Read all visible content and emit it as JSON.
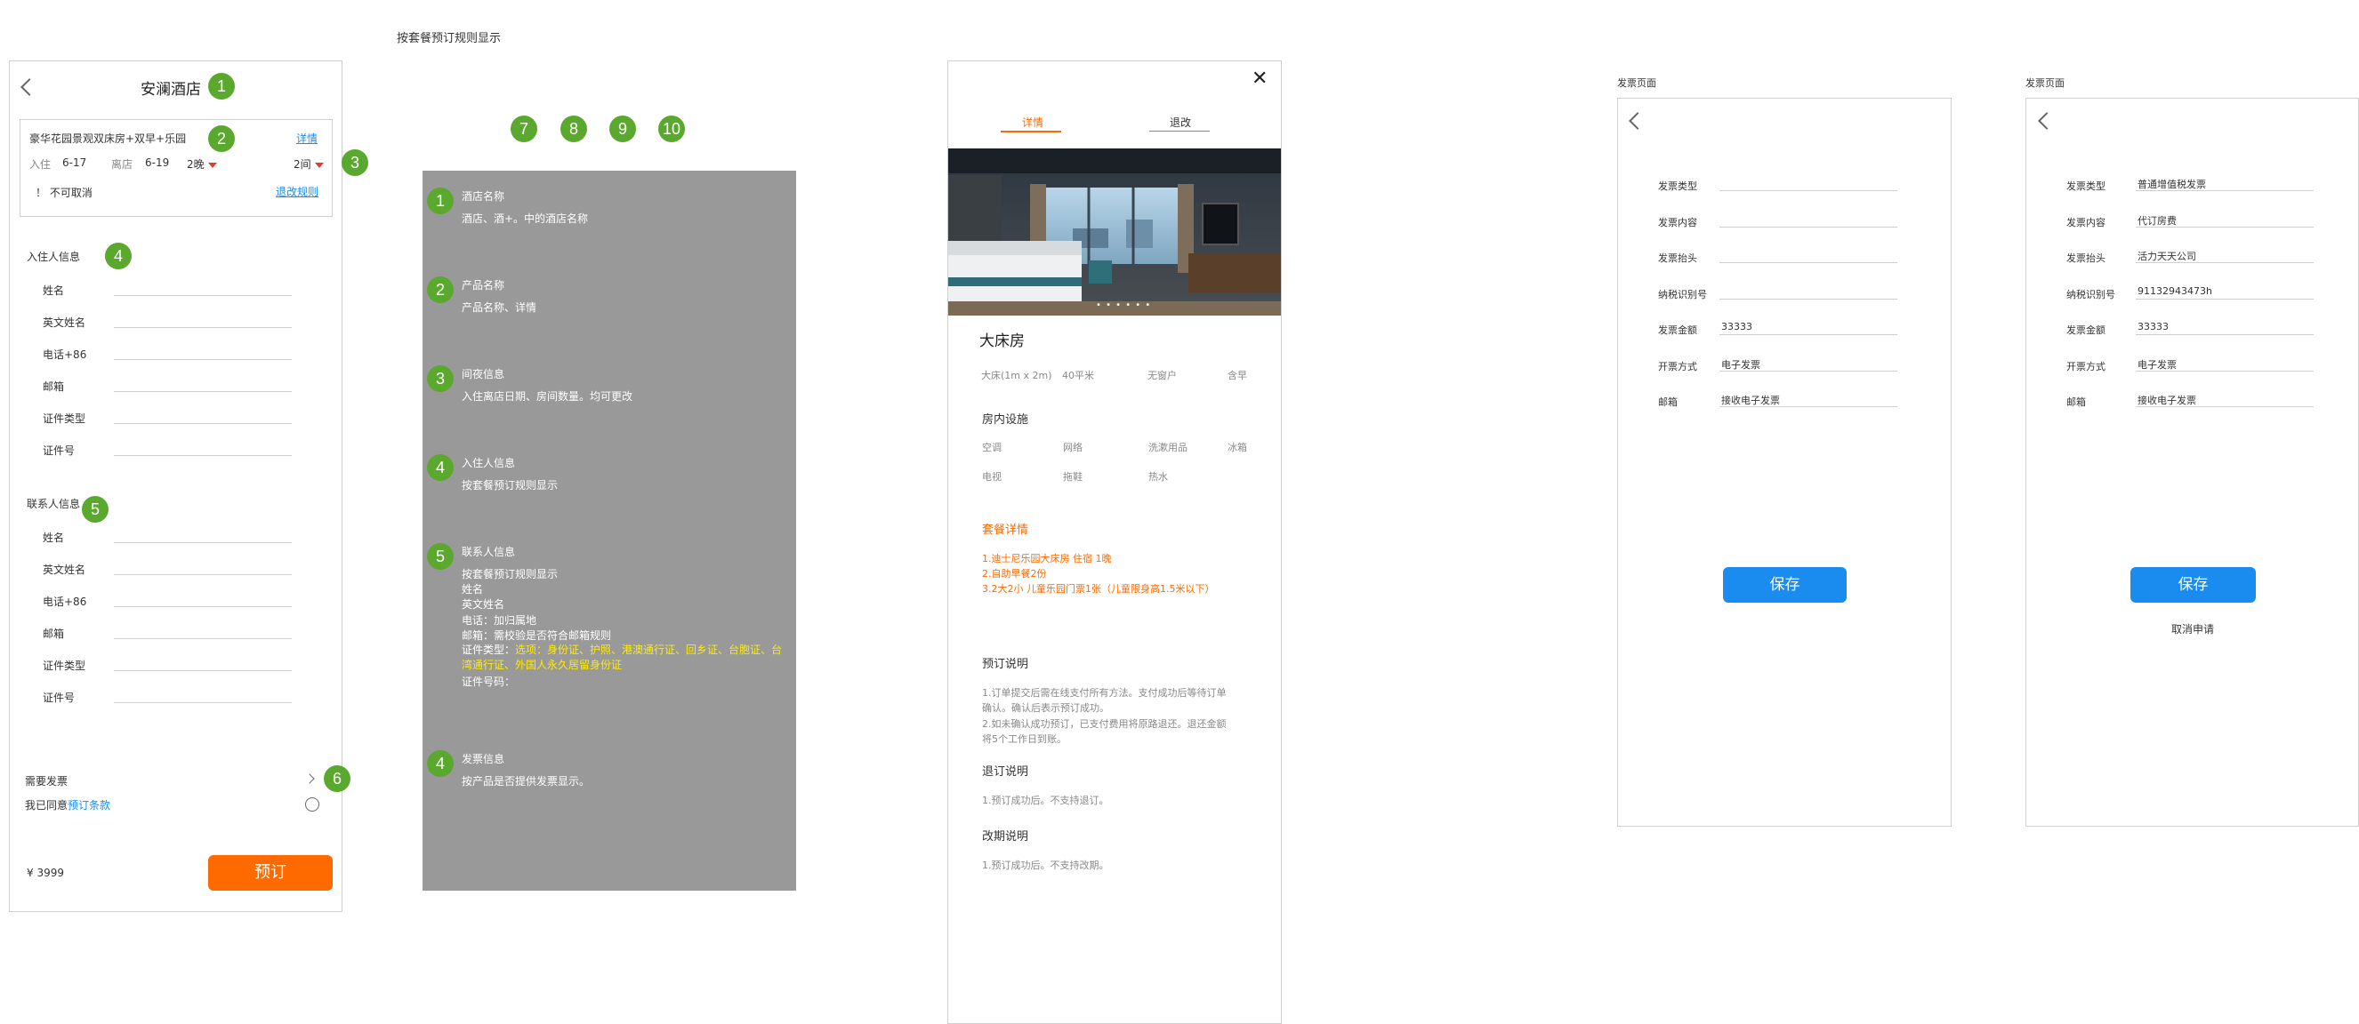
{
  "top_note": "按套餐预订规则显示",
  "booking": {
    "title": "安澜酒店",
    "product": "豪华花园景观双床房+双早+乐园",
    "detail_link": "详情",
    "checkin_label": "入住",
    "checkin_date": "6-17",
    "checkout_label": "离店",
    "checkout_date": "6-19",
    "nights": "2晚",
    "rooms": "2间",
    "cancel_note": "！ 不可取消",
    "change_rule": "退改规则",
    "guest_section": "入住人信息",
    "guest_fields": [
      "姓名",
      "英文姓名",
      "电话+86",
      "邮箱",
      "证件类型",
      "证件号"
    ],
    "contact_section": "联系人信息",
    "contact_fields": [
      "姓名",
      "英文姓名",
      "电话+86",
      "邮箱",
      "证件类型",
      "证件号"
    ],
    "invoice_label": "需要发票",
    "agree_prefix": "我已同意",
    "agree_link": "预订条款",
    "price": "¥ 3999",
    "book_button": "预订"
  },
  "badges": [
    "1",
    "2",
    "3",
    "4",
    "5",
    "6",
    "7",
    "8",
    "9",
    "10"
  ],
  "notes": [
    {
      "num": "1",
      "title": "酒店名称",
      "body": "酒店、酒+。中的酒店名称"
    },
    {
      "num": "2",
      "title": "产品名称",
      "body": "产品名称、详情"
    },
    {
      "num": "3",
      "title": "间夜信息",
      "body": "入住离店日期、房间数量。均可更改"
    },
    {
      "num": "4",
      "title": "入住人信息",
      "body": "按套餐预订规则显示"
    },
    {
      "num": "5",
      "title": "联系人信息",
      "body_lines": [
        "按套餐预订规则显示",
        "姓名",
        "英文姓名",
        "电话：加归属地",
        "邮箱：需校验是否符合邮箱规则"
      ],
      "id_prefix": "证件类型：",
      "id_options": "选项：身份证、护照、港澳通行证、回乡证、台胞证、台湾通行证、外国人永久居留身份证",
      "id_number": "证件号码："
    },
    {
      "num": "4",
      "title": "发票信息",
      "body": "按产品是否提供发票显示。"
    }
  ],
  "detail": {
    "close": "✕",
    "tab_active": "详情",
    "tab_other": "退改",
    "room_name": "大床房",
    "room_specs": [
      "大床(1m x 2m)",
      "40平米",
      "无窗户",
      "含早"
    ],
    "facilities_title": "房内设施",
    "facilities": [
      "空调",
      "网络",
      "洗漱用品",
      "冰箱",
      "电视",
      "拖鞋",
      "热水"
    ],
    "package_title": "套餐详情",
    "package_items": [
      "1.迪士尼乐园大床房 住宿 1晚",
      "2.自助早餐2份",
      "3.2大2小 儿童乐园门票1张（儿童限身高1.5米以下）"
    ],
    "booking_title": "预订说明",
    "booking_lines": [
      "1.订单提交后需在线支付所有方法。支付成功后等待订单",
      "确认。确认后表示预订成功。",
      "2.如未确认成功预订，已支付费用将原路退还。退还金额",
      "将5个工作日到账。"
    ],
    "refund_title": "退订说明",
    "refund_text": "1.预订成功后。不支持退订。",
    "modify_title": "改期说明",
    "modify_text": "1.预订成功后。不支持改期。"
  },
  "invoice_a": {
    "caption": "发票页面",
    "fields": [
      {
        "label": "发票类型",
        "value": ""
      },
      {
        "label": "发票内容",
        "value": ""
      },
      {
        "label": "发票抬头",
        "value": ""
      },
      {
        "label": "纳税识别号",
        "value": ""
      },
      {
        "label": "发票金额",
        "value": "33333"
      },
      {
        "label": "开票方式",
        "value": "电子发票"
      },
      {
        "label": "邮箱",
        "value": "接收电子发票"
      }
    ],
    "save": "保存"
  },
  "invoice_b": {
    "caption": "发票页面",
    "fields": [
      {
        "label": "发票类型",
        "value": "普通增值税发票"
      },
      {
        "label": "发票内容",
        "value": "代订房费"
      },
      {
        "label": "发票抬头",
        "value": "活力天天公司"
      },
      {
        "label": "纳税识别号",
        "value": "91132943473h"
      },
      {
        "label": "发票金额",
        "value": "33333"
      },
      {
        "label": "开票方式",
        "value": "电子发票"
      },
      {
        "label": "邮箱",
        "value": "接收电子发票"
      }
    ],
    "save": "保存",
    "cancel": "取消申请"
  },
  "colors": {
    "accent_orange": "#ff6a00",
    "accent_blue": "#1a8cf0",
    "badge_green": "#5aa82d",
    "note_bg": "#999999"
  }
}
